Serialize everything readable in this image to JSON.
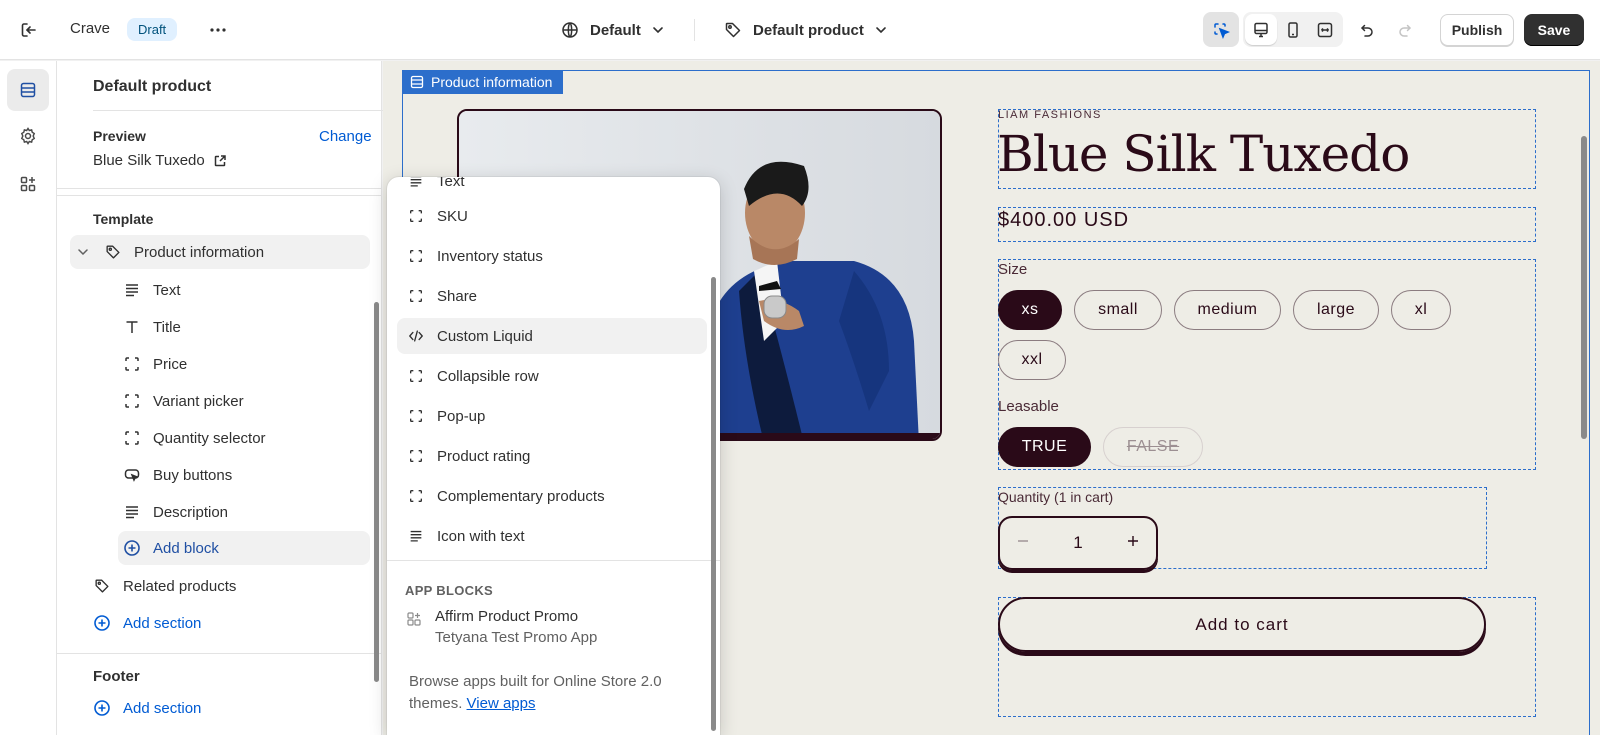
{
  "topbar": {
    "store_name": "Crave",
    "status_badge": "Draft",
    "theme_label": "Default",
    "template_label": "Default product",
    "publish_label": "Publish",
    "save_label": "Save"
  },
  "sidebar": {
    "title": "Default product",
    "preview_label": "Preview",
    "change_label": "Change",
    "preview_value": "Blue Silk Tuxedo",
    "template_heading": "Template",
    "section_name": "Product information",
    "blocks": [
      "Text",
      "Title",
      "Price",
      "Variant picker",
      "Quantity selector",
      "Buy buttons",
      "Description"
    ],
    "add_block_label": "Add block",
    "related_products_label": "Related products",
    "add_section_label": "Add section",
    "footer_heading": "Footer",
    "footer_add_section_label": "Add section"
  },
  "popover": {
    "partial_item": "Text",
    "items": [
      "SKU",
      "Inventory status",
      "Share",
      "Custom Liquid",
      "Collapsible row",
      "Pop-up",
      "Product rating",
      "Complementary products",
      "Icon with text"
    ],
    "hovered_item": "Custom Liquid",
    "app_blocks_heading": "APP BLOCKS",
    "app_name": "Affirm Product Promo",
    "app_vendor": "Tetyana Test Promo App",
    "footer_text": "Browse apps built for Online Store 2.0 themes.",
    "footer_link": "View apps"
  },
  "preview": {
    "section_tag": "Product information",
    "vendor": "LIAM FASHIONS",
    "product_title": "Blue Silk Tuxedo",
    "price": "$400.00 USD",
    "size_label": "Size",
    "sizes": [
      "xs",
      "small",
      "medium",
      "large",
      "xl",
      "xxl"
    ],
    "selected_size": "xs",
    "leasable_label": "Leasable",
    "leasable_options": [
      "TRUE",
      "FALSE"
    ],
    "selected_leasable": "TRUE",
    "quantity_label": "Quantity (1 in cart)",
    "quantity_value": "1",
    "add_to_cart_label": "Add to cart"
  },
  "colors": {
    "accent": "#2c6ecb",
    "brand_dark": "#2a0a18",
    "canvas_bg": "#eeede6",
    "link": "#005bd3"
  },
  "icons": {
    "exit": "exit-icon",
    "more": "more-horizontal-icon",
    "theme": "globe-icon",
    "template": "tag-icon",
    "inspector": "select-cursor-icon",
    "desktop": "desktop-icon",
    "mobile": "mobile-icon",
    "full_width": "full-width-icon",
    "undo": "undo-icon",
    "redo": "redo-icon"
  }
}
